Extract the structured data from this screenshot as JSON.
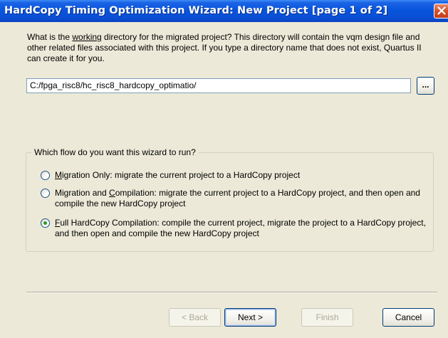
{
  "window": {
    "title": "HardCopy Timing Optimization Wizard: New Project [page 1 of 2]"
  },
  "question": {
    "pre": "What is the ",
    "underlined": "working",
    "post": " directory for the migrated project? This directory will contain the vqm design file and other related files associated with this project. If you type a directory name that does not exist, Quartus II can create it for you."
  },
  "directory": {
    "value": "C:/fpga_risc8/hc_risc8_hardcopy_optimatio/",
    "browse_label": "..."
  },
  "flow_group": {
    "label": "Which flow do you want this wizard to run?",
    "options": [
      {
        "key": "M",
        "rest": "igration Only: migrate the current project to a HardCopy project",
        "checked": false
      },
      {
        "pre": "Migration and ",
        "key": "C",
        "rest": "ompilation: migrate the current project to a HardCopy project, and then open and compile the new HardCopy project",
        "checked": false
      },
      {
        "key": "F",
        "rest": "ull HardCopy Compilation: compile the current project, migrate the project to a HardCopy project, and then open and compile the new HardCopy project",
        "checked": true
      }
    ]
  },
  "buttons": {
    "back": "< Back",
    "next": "Next >",
    "finish": "Finish",
    "cancel": "Cancel"
  },
  "colors": {
    "titlebar": "#0855dd",
    "face": "#ece9d8",
    "radio_dot": "#21a121"
  }
}
